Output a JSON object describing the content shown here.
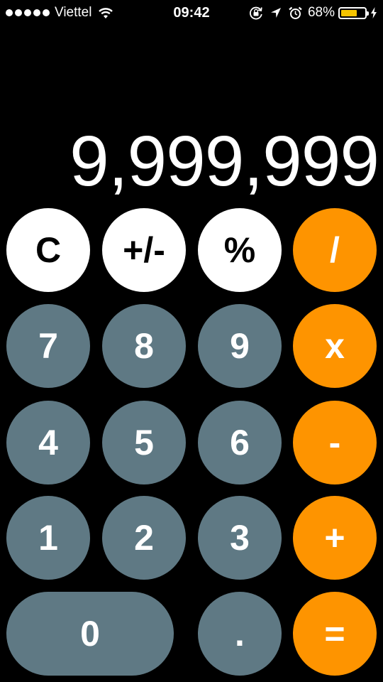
{
  "status_bar": {
    "carrier": "Viettel",
    "time": "09:42",
    "battery_percent": "68%",
    "battery_level": 0.68,
    "battery_color": "#f5c400",
    "icons": [
      "signal-dots",
      "wifi-icon",
      "rotation-lock-icon",
      "location-arrow-icon",
      "alarm-clock-icon",
      "battery-icon",
      "charging-bolt-icon"
    ]
  },
  "display": {
    "value": "9,999,999"
  },
  "keys": {
    "clear": "C",
    "sign": "+/-",
    "percent": "%",
    "divide": "/",
    "seven": "7",
    "eight": "8",
    "nine": "9",
    "multiply": "x",
    "four": "4",
    "five": "5",
    "six": "6",
    "minus": "-",
    "one": "1",
    "two": "2",
    "three": "3",
    "plus": "+",
    "zero": "0",
    "decimal": ".",
    "equals": "="
  },
  "colors": {
    "background": "#000000",
    "function_key": "#ffffff",
    "number_key": "#5f7984",
    "operator_key": "#fe9400"
  }
}
